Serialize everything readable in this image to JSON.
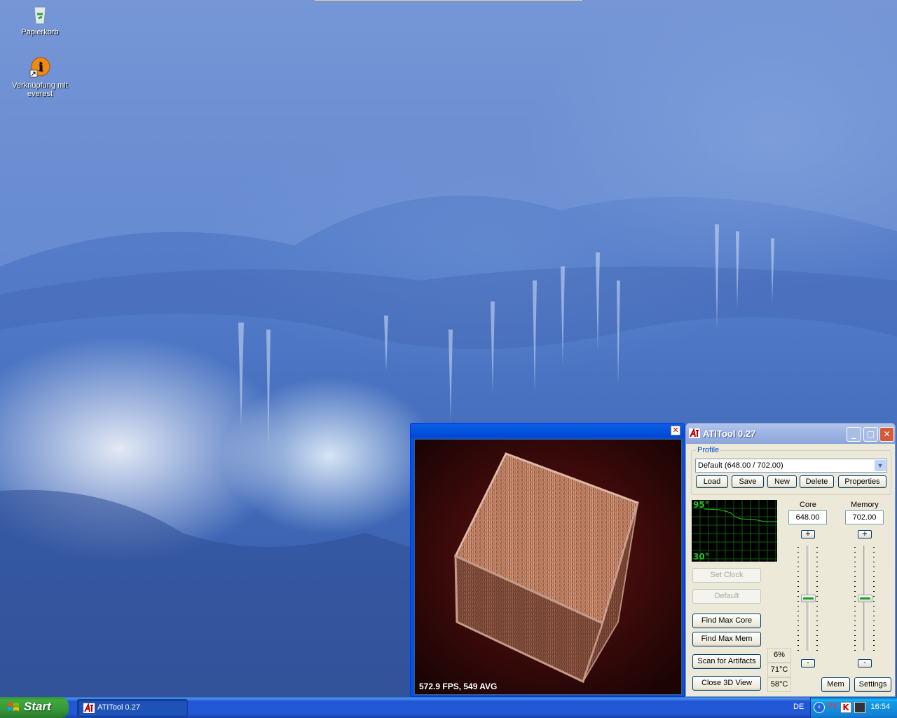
{
  "desktop": {
    "icons": [
      {
        "label": "Papierkorb",
        "icon": "recycle-bin-icon"
      },
      {
        "label": "Verknüpfung mit everest",
        "icon": "everest-shortcut-icon"
      }
    ]
  },
  "view3d": {
    "fps_text": "572.9 FPS, 549 AVG"
  },
  "atitool": {
    "title": "ATITool 0.27",
    "profile_label": "Profile",
    "profile_selected": "Default (648.00 / 702.00)",
    "profile_buttons": [
      "Load",
      "Save",
      "New",
      "Delete",
      "Properties"
    ],
    "graph": {
      "max_label": "95°",
      "min_label": "30°"
    },
    "core": {
      "label": "Core",
      "value": "648.00",
      "plus": "+",
      "minus": "-"
    },
    "memory": {
      "label": "Memory",
      "value": "702.00",
      "plus": "+",
      "minus": "-"
    },
    "buttons": {
      "set_clock": "Set Clock",
      "default": "Default",
      "find_max_core": "Find Max Core",
      "find_max_mem": "Find Max Mem",
      "scan_artifacts": "Scan for Artifacts",
      "close_3d": "Close 3D View",
      "mem": "Mem",
      "settings": "Settings"
    },
    "status": {
      "load": "6%",
      "temp1": "71°C",
      "temp2": "58°C"
    },
    "colors": {
      "graph_line": "#22c022",
      "graph_label": "#22c022"
    }
  },
  "taskbar": {
    "start_label": "Start",
    "tasks": [
      {
        "label": "ATITool 0.27"
      }
    ],
    "tray": {
      "language": "DE",
      "temp_badge": "71",
      "clock": "16:54"
    }
  }
}
